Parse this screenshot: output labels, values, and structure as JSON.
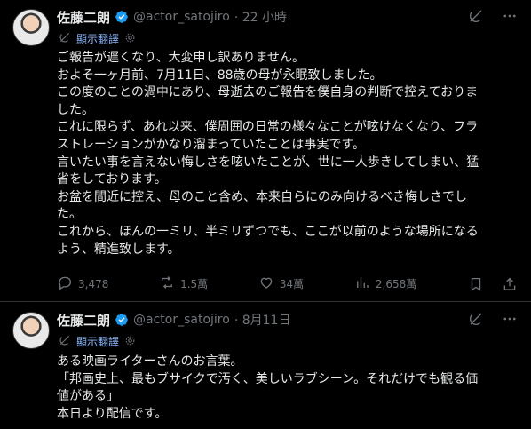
{
  "tweets": [
    {
      "name": "佐藤二朗",
      "handle": "@actor_satojiro",
      "time": "· 22 小時",
      "translate_label": "顯示翻譯",
      "lines": [
        "ご報告が遅くなり、大変申し訳ありません。",
        "およそ一ヶ月前、7月11日、88歳の母が永眠致しました。",
        "この度のことの渦中にあり、母逝去のご報告を僕自身の判断で控えておりま",
        "した。",
        "これに限らず、あれ以来、僕周囲の日常の様々なことが呟けなくなり、フラ",
        "ストレーションがかなり溜まっていたことは事実です。",
        "言いたい事を言えない悔しさを呟いたことが、世に一人歩きしてしまい、猛",
        "省をしております。",
        "お盆を間近に控え、母のこと含め、本来自らにのみ向けるべき悔しさでし",
        "た。",
        "これから、ほんの一ミリ、半ミリずつでも、ここが以前のような場所になる",
        "よう、精進致します。"
      ],
      "stats": {
        "replies": "3,478",
        "reposts": "1.5萬",
        "likes": "34萬",
        "views": "2,658萬"
      }
    },
    {
      "name": "佐藤二朗",
      "handle": "@actor_satojiro",
      "time": "· 8月11日",
      "translate_label": "顯示翻譯",
      "lines": [
        "ある映画ライターさんのお言葉。",
        "「邦画史上、最もブサイクで汚く、美しいラブシーン。それだけでも観る価",
        "値がある」",
        "本日より配信です。"
      ]
    }
  ],
  "icons": {
    "verified": "verified-badge-icon",
    "grok": "grok-icon",
    "more": "more-icon",
    "translate": "translate-icon",
    "gear": "gear-icon",
    "reply": "reply-icon",
    "repost": "repost-icon",
    "like": "like-icon",
    "views": "views-icon",
    "bookmark": "bookmark-icon",
    "share": "share-icon"
  },
  "colors": {
    "accent": "#1d9bf0",
    "muted": "#71767b",
    "text": "#e7e9ea",
    "bg": "#000000"
  }
}
